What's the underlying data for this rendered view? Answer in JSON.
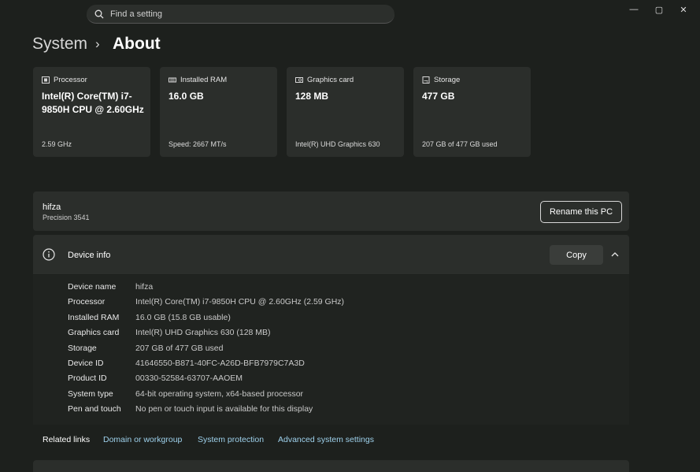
{
  "search": {
    "placeholder": "Find a setting"
  },
  "window_controls": {
    "minimize": "—",
    "maximize": "▢",
    "close": "✕"
  },
  "breadcrumb": {
    "parent": "System",
    "separator": "›",
    "current": "About"
  },
  "specs": [
    {
      "title": "Processor",
      "value": "Intel(R) Core(TM) i7-9850H CPU @ 2.60GHz",
      "sub": "2.59 GHz",
      "icon": "processor-icon"
    },
    {
      "title": "Installed RAM",
      "value": "16.0 GB",
      "sub": "Speed: 2667 MT/s",
      "icon": "ram-icon"
    },
    {
      "title": "Graphics card",
      "value": "128 MB",
      "sub": "Intel(R) UHD Graphics 630",
      "icon": "graphics-card-icon"
    },
    {
      "title": "Storage",
      "value": "477 GB",
      "sub": "207 GB of 477 GB used",
      "icon": "storage-icon"
    }
  ],
  "pc": {
    "name": "hifza",
    "model": "Precision 3541",
    "rename_label": "Rename this PC"
  },
  "device_info": {
    "title": "Device info",
    "copy_label": "Copy",
    "properties": [
      {
        "label": "Device name",
        "value": "hifza"
      },
      {
        "label": "Processor",
        "value": "Intel(R) Core(TM) i7-9850H CPU @ 2.60GHz (2.59 GHz)"
      },
      {
        "label": "Installed RAM",
        "value": "16.0 GB (15.8 GB usable)"
      },
      {
        "label": "Graphics card",
        "value": "Intel(R) UHD Graphics 630 (128 MB)"
      },
      {
        "label": "Storage",
        "value": "207 GB of 477 GB used"
      },
      {
        "label": "Device ID",
        "value": "41646550-B871-40FC-A26D-BFB7979C7A3D"
      },
      {
        "label": "Product ID",
        "value": "00330-52584-63707-AAOEM"
      },
      {
        "label": "System type",
        "value": "64-bit operating system, x64-based processor"
      },
      {
        "label": "Pen and touch",
        "value": "No pen or touch input is available for this display"
      }
    ]
  },
  "related": {
    "title": "Related links",
    "links": [
      "Domain or workgroup",
      "System protection",
      "Advanced system settings"
    ]
  },
  "colors": {
    "background": "#1d201d",
    "card": "#2b2e2b",
    "link": "#9ed1ec"
  }
}
